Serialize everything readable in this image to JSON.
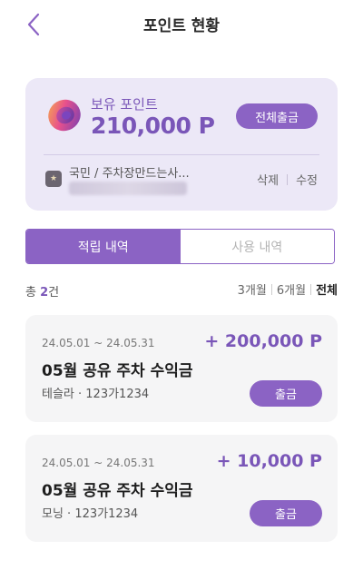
{
  "header": {
    "title": "포인트 현황"
  },
  "points_card": {
    "label": "보유 포인트",
    "value": "210,000 P",
    "withdraw_all_label": "전체출금",
    "account_name": "국민 / 주차장만드는사...",
    "delete_label": "삭제",
    "edit_label": "수정"
  },
  "tabs": [
    {
      "label": "적립 내역",
      "active": true
    },
    {
      "label": "사용 내역",
      "active": false
    }
  ],
  "summary": {
    "count_prefix": "총",
    "count_value": "2",
    "count_suffix": "건"
  },
  "periods": [
    {
      "label": "3개월",
      "selected": false
    },
    {
      "label": "6개월",
      "selected": false
    },
    {
      "label": "전체",
      "selected": true
    }
  ],
  "items": [
    {
      "date_range": "24.05.01 ~ 24.05.31",
      "amount": "+ 200,000 P",
      "title": "05월 공유 주차 수익금",
      "subtitle": "테슬라 · 123가1234",
      "button_label": "출금"
    },
    {
      "date_range": "24.05.01 ~ 24.05.31",
      "amount": "+ 10,000 P",
      "title": "05월 공유 주차 수익금",
      "subtitle": "모닝 · 123가1234",
      "button_label": "출금"
    }
  ],
  "colors": {
    "accent": "#8b63c4",
    "accent_text": "#7a56b8",
    "card_bg": "#ece8f7"
  },
  "icons": {
    "back": "chevron-left-icon",
    "coin": "coin-icon",
    "bank": "bank-icon"
  }
}
